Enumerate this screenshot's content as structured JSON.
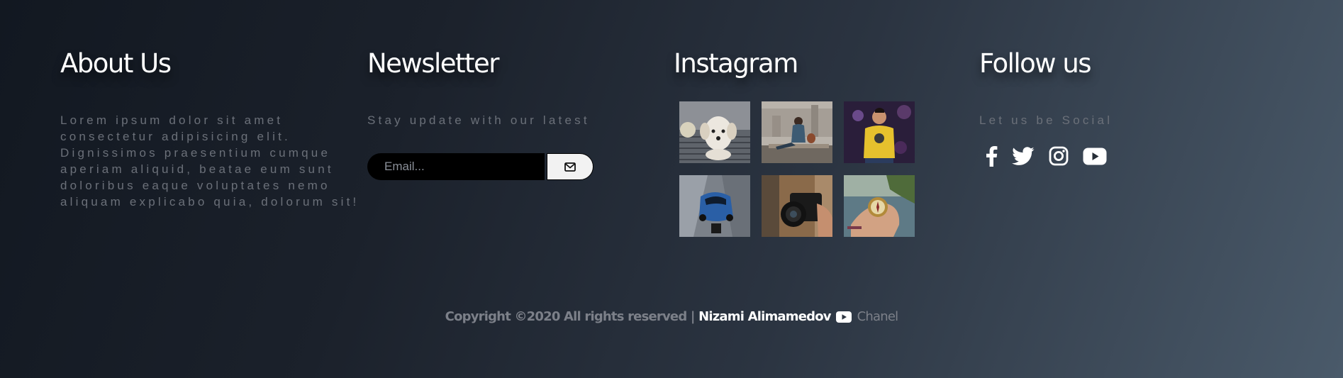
{
  "about": {
    "title": "About Us",
    "text": "Lorem ipsum dolor sit amet consectetur adipisicing elit. Dignissimos praesentium cumque aperiam aliquid, beatae eum sunt doloribus eaque voluptates nemo aliquam explicabo quia, dolorum sit!"
  },
  "newsletter": {
    "title": "Newsletter",
    "subtitle": "Stay update with our latest",
    "email_placeholder": "Email...",
    "send_icon": "envelope-icon"
  },
  "instagram": {
    "title": "Instagram",
    "photos": [
      "dog-photo",
      "woman-city-photo",
      "man-yellow-sweater-photo",
      "blue-car-photo",
      "camera-photo",
      "compass-photo"
    ]
  },
  "follow": {
    "title": "Follow us",
    "subtitle": "Let us be Social",
    "icons": [
      "facebook-icon",
      "twitter-icon",
      "instagram-icon",
      "youtube-icon"
    ]
  },
  "footer": {
    "copyright": "Copyright ©2020 All rights reserved |",
    "author": "Nizami Alimamedov",
    "channel": "Chanel"
  }
}
